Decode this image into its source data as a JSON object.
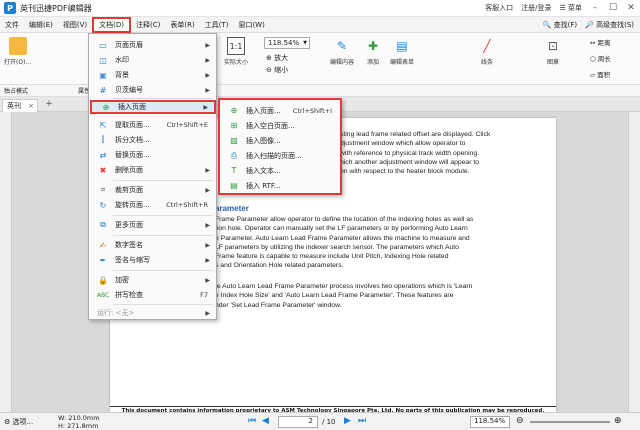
{
  "window": {
    "title": "英刊迅捷PDF编辑器",
    "logo_letter": "P",
    "right": [
      "客服入口",
      "注册/登录",
      "菜单"
    ]
  },
  "menubar": {
    "items": [
      "文件",
      "编辑(E)",
      "视图(V)",
      "文档(D)",
      "注释(C)",
      "表单(R)",
      "工具(T)",
      "窗口(W)"
    ],
    "right": [
      "查找(F)",
      "高级查找(S)"
    ]
  },
  "toolbar": {
    "open": "打开(O)...",
    "actual_size": "实际大小",
    "zoom_value": "118.54%",
    "zoom_in": "放大",
    "zoom_out": "缩小",
    "edit_content": "编辑内容",
    "add": "添加",
    "edit_form": "编辑表单",
    "line": "线条",
    "seal": "图章",
    "distance": "距离",
    "perimeter": "周长",
    "area": "面积"
  },
  "toolbar2": {
    "items": [
      "独占模式",
      "属性(P)..."
    ]
  },
  "tabs": {
    "active": "英刊"
  },
  "document": {
    "lines_top": [
      "sting lead frame related offset are displayed. Click",
      "djustment window which allow operator to",
      "with reference to physical track width opening.",
      "hich another adjustment window will appear to",
      "on with respect to the heater block module."
    ],
    "heading": "arameter",
    "lines_mid": [
      "Frame Parameter allow operator to define the location of the indexing holes as well as",
      "tion hole. Operator can manually set the LF parameters or by performing Auto Learn",
      "e Parameter. Auto Learn Lead Frame Parameter allows the machine to measure and",
      "LF parameters by utilizing the indexer search sensor. The parameters which Auto",
      "Frame feature is capable to measure include Unit Pitch, Indexing Hole related",
      "s and Orientation Hole related parameters."
    ],
    "lines_bottom": [
      "te Auto Learn Lead Frame Parameter process involves two operations which is 'Learn",
      "e Index Hole Size' and 'Auto Learn Lead Frame Parameter'. These features are",
      "nder 'Set Lead Frame Parameter' window."
    ],
    "footer": "This document contains information proprietary to ASM Technology Singapore Pte. Ltd. No parts of this publication may be reproduced, photocopied, stored on a"
  },
  "dropdown": {
    "items": [
      {
        "label": "页面页眉",
        "arrow": true
      },
      {
        "label": "水印",
        "arrow": true
      },
      {
        "label": "背景",
        "arrow": true
      },
      {
        "label": "贝茨编号",
        "arrow": true
      },
      {
        "label": "插入页面",
        "arrow": true
      },
      {
        "label": "提取页面...",
        "shortcut": "Ctrl+Shift+E"
      },
      {
        "label": "拆分文档..."
      },
      {
        "label": "替换页面..."
      },
      {
        "label": "删除页面",
        "arrow": true
      },
      {
        "label": "裁剪页面",
        "arrow": true
      },
      {
        "label": "旋转页面...",
        "shortcut": "Ctrl+Shift+R"
      },
      {
        "label": "更多页面",
        "arrow": true
      },
      {
        "label": "数字签名",
        "arrow": true
      },
      {
        "label": "签名与缩写",
        "arrow": true
      },
      {
        "label": "加密",
        "arrow": true
      },
      {
        "label": "拼写检查",
        "shortcut": "F7"
      },
      {
        "label": "运行: <无>",
        "arrow": true
      }
    ]
  },
  "submenu": {
    "items": [
      {
        "label": "插入页面...",
        "shortcut": "Ctrl+Shift+I"
      },
      {
        "label": "插入空白页面..."
      },
      {
        "label": "插入图像..."
      },
      {
        "label": "插入扫描的页面..."
      },
      {
        "label": "插入文本..."
      },
      {
        "label": "插入 RTF..."
      }
    ]
  },
  "statusbar": {
    "select": "选项...",
    "width": "W: 210.0mm",
    "height": "H: 271.8mm",
    "page_current": "2",
    "page_total": "/ 10",
    "zoom": "118.54%"
  },
  "colors": {
    "highlight_red": "#e53935",
    "brand_blue": "#1b7fd6",
    "heading_blue": "#2b5fa8"
  }
}
